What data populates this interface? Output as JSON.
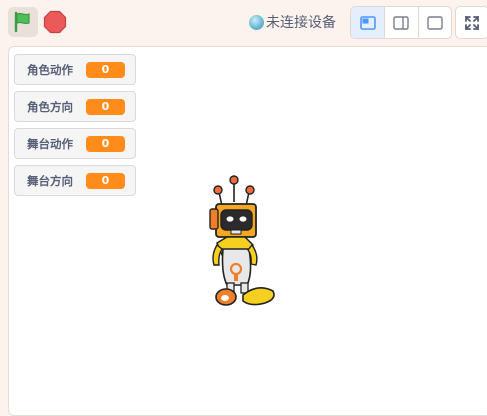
{
  "toolbar": {
    "device_status": "未连接设备",
    "icons": {
      "green_flag": "green-flag-icon",
      "stop": "stop-icon",
      "small_stage": "small-stage-icon",
      "side_stage": "side-stage-icon",
      "large_stage": "large-stage-icon",
      "fullscreen": "fullscreen-icon"
    }
  },
  "monitors": [
    {
      "label": "角色动作",
      "value": "0"
    },
    {
      "label": "角色方向",
      "value": "0"
    },
    {
      "label": "舞台动作",
      "value": "0"
    },
    {
      "label": "舞台方向",
      "value": "0"
    }
  ],
  "colors": {
    "monitor_value": "#ff8c1a",
    "flag": "#4cbf56",
    "stop": "#ec5959",
    "background": "#fdf3ee"
  }
}
